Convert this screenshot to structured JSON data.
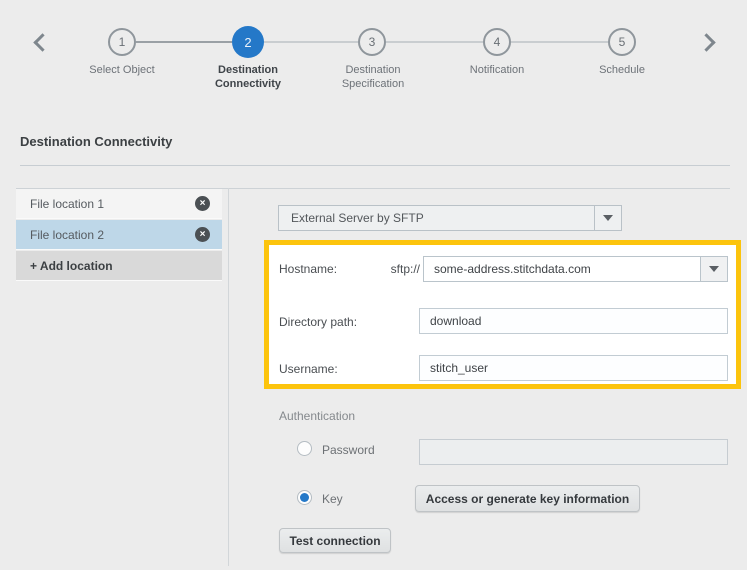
{
  "stepper": {
    "steps": [
      {
        "number": "1",
        "label": "Select Object"
      },
      {
        "number": "2",
        "label": "Destination Connectivity"
      },
      {
        "number": "3",
        "label": "Destination Specification"
      },
      {
        "number": "4",
        "label": "Notification"
      },
      {
        "number": "5",
        "label": "Schedule"
      }
    ],
    "active_step": "2"
  },
  "section": {
    "title": "Destination Connectivity"
  },
  "locations": {
    "items": [
      {
        "label": "File location 1"
      },
      {
        "label": "File location 2"
      }
    ],
    "selected": "File location 2",
    "add_label": "+ Add location",
    "remove_icon": "×"
  },
  "form": {
    "destination_type": {
      "value": "External Server by SFTP"
    },
    "hostname": {
      "label": "Hostname:",
      "prefix": "sftp://",
      "value": "some-address.stitchdata.com"
    },
    "directory": {
      "label": "Directory path:",
      "value": "download"
    },
    "username": {
      "label": "Username:",
      "value": "stitch_user"
    },
    "authentication": {
      "label": "Authentication",
      "password_option": "Password",
      "password_value": "",
      "key_option": "Key",
      "key_button": "Access or generate key information",
      "selected_option": "Key"
    },
    "test_button": "Test connection"
  },
  "colors": {
    "accent_blue": "#2478c8",
    "highlight_yellow": "#fcc40d",
    "selected_row_blue": "#bed7e8",
    "background": "#ececec"
  }
}
